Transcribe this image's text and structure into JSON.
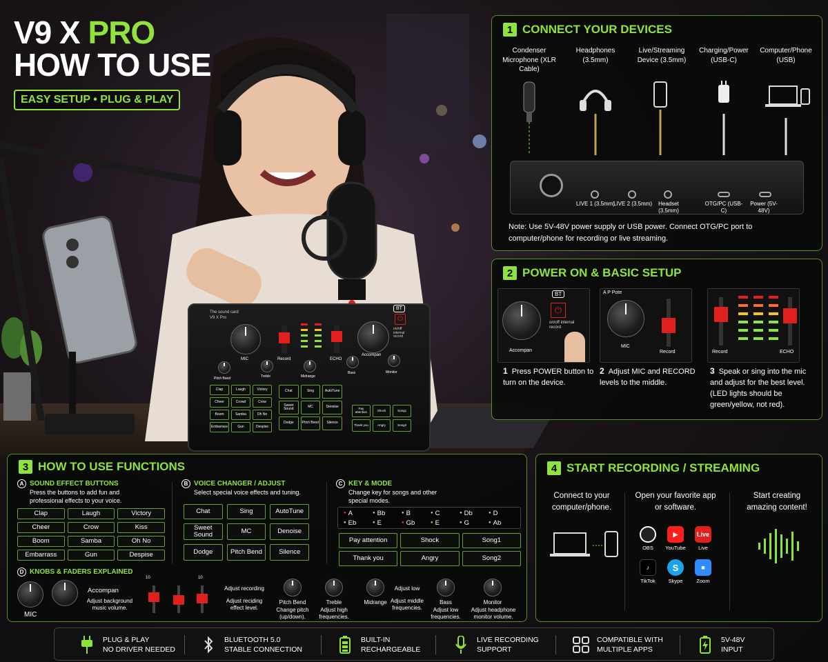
{
  "hero": {
    "title_part1": "V9 X",
    "title_part2": "PRO",
    "title_line2": "HOW TO USE",
    "tagline": "EASY SETUP • PLUG & PLAY"
  },
  "mixer_device": {
    "brand": "The sound card",
    "model": "V9 X Pro",
    "bt": "BT",
    "onoff": "on/off internal record",
    "labels": [
      "MIC",
      "Record",
      "ECHO",
      "Accompan",
      "Pitch Band",
      "Treble",
      "Midrange",
      "Bass",
      "Monitor"
    ],
    "pads_left": [
      "Clap",
      "Laugh",
      "Victory",
      "Cheer",
      "Crowd",
      "Crow",
      "Boom",
      "Samba",
      "Oh No",
      "Embarrass",
      "Gun",
      "Despise"
    ],
    "pads_mid": [
      "Chat",
      "Sing",
      "AutoTune",
      "Sweet Sound",
      "MC",
      "Denoise",
      "Dodge",
      "Pitch Bend",
      "Silence"
    ],
    "pads_right": [
      "Pay attention",
      "Shock",
      "Song1",
      "Thank you",
      "Angry",
      "Song2"
    ]
  },
  "step1": {
    "num": "1",
    "title": "CONNECT YOUR DEVICES",
    "devices": [
      {
        "name": "Condenser Microphone (XLR Cable)"
      },
      {
        "name": "Headphones (3.5mm)"
      },
      {
        "name": "Live/Streaming Device (3.5mm)"
      },
      {
        "name": "Charging/Power (USB-C)"
      },
      {
        "name": "Computer/Phone (USB)"
      }
    ],
    "ports": [
      "LIVE 1 (3.5mm)",
      "LIVE 2 (3.5mm)",
      "Headset (3.5mm)",
      "OTG/PC (USB-C)",
      "Power (5V-48V)"
    ],
    "note": "Note: Use 5V-48V power supply or USB power.  Connect OTG/PC port to computer/phone for recording or live streaming."
  },
  "step2": {
    "num": "2",
    "title": "POWER ON & BASIC SETUP",
    "cards": [
      {
        "knob_label": "Accompan",
        "bt": "BT",
        "onoff": "on/off internal record"
      },
      {
        "top": "A P Pote",
        "knob_label": "MIC",
        "fader_label": "Record"
      },
      {
        "left": "Record",
        "right": "ECHO"
      }
    ],
    "steps": [
      {
        "n": "1",
        "text": "Press POWER button to turn on the device."
      },
      {
        "n": "2",
        "text": "Adjust MIC and RECORD levels to the middle."
      },
      {
        "n": "3",
        "text": "Speak or sing into the mic and adjust for the best level. (LED lights should be green/yellow, not red)."
      }
    ]
  },
  "step3": {
    "num": "3",
    "title": "HOW TO USE FUNCTIONS",
    "a": {
      "letter": "A",
      "title": "SOUND EFFECT BUTTONS",
      "desc": "Press the buttons to add fun and professional effects to your voice.",
      "buttons": [
        "Clap",
        "Laugh",
        "Victory",
        "Cheer",
        "Crow",
        "Kiss",
        "Boom",
        "Samba",
        "Oh No",
        "Embarrass",
        "Gun",
        "Despise"
      ]
    },
    "b": {
      "letter": "B",
      "title": "VOICE CHANGER / ADJUST",
      "desc": "Select special voice effects and tuning.",
      "buttons": [
        "Chat",
        "Sing",
        "AutoTune",
        "Sweet Sound",
        "MC",
        "Denoise",
        "Dodge",
        "Pitch Bend",
        "Silence"
      ]
    },
    "c": {
      "letter": "C",
      "title": "KEY & MODE",
      "desc": "Change key for songs and other special modes.",
      "keys_row1": [
        "A",
        "Bb",
        "B",
        "C",
        "Db",
        "D"
      ],
      "keys_row2": [
        "Eb",
        "E",
        "Gb",
        "E",
        "G",
        "Ab"
      ],
      "buttons": [
        "Pay attention",
        "Shock",
        "Song1",
        "Thank you",
        "Angry",
        "Song2"
      ]
    },
    "d": {
      "letter": "D",
      "title": "KNOBS & FADERS EXPLAINED",
      "mic": "MIC",
      "accompan": "Accompan",
      "accompan_desc": "Adjust background music volume.",
      "fader_marks": [
        "10",
        "",
        "10"
      ],
      "adj_rec": "Adjust recording",
      "adj_eff": "Adjust reciding effect level.",
      "knobs": [
        {
          "name": "Pitch Bend",
          "desc": "Change pitch (up/down)."
        },
        {
          "name": "Treble",
          "desc": "Adjust high frequencies."
        },
        {
          "name": "Midrange",
          "desc": "Adjust middle frequencies.",
          "top": "Adjust low"
        },
        {
          "name": "Bass",
          "desc": "Adjust low frequencies."
        },
        {
          "name": "Monitor",
          "desc": "Adjust headphone monitor volume."
        }
      ]
    }
  },
  "step4": {
    "num": "4",
    "title": "START RECORDING / STREAMING",
    "col1": "Connect to your computer/phone.",
    "col2": "Open your favorite app or software.",
    "col3": "Start creating amazing content!",
    "apps": [
      {
        "name": "OBS",
        "icon": "obs-icon"
      },
      {
        "name": "YouTube",
        "icon": "youtube-icon"
      },
      {
        "name": "Live",
        "icon": "live-icon",
        "glyph": "Live"
      },
      {
        "name": "TikTok",
        "icon": "tiktok-icon"
      },
      {
        "name": "Skype",
        "icon": "skype-icon",
        "glyph": "S"
      },
      {
        "name": "Zoom",
        "icon": "zoom-icon"
      }
    ]
  },
  "features": [
    {
      "line1": "PLUG & PLAY",
      "line2": "NO DRIVER NEEDED",
      "icon": "plug-icon"
    },
    {
      "line1": "BLUETOOTH 5.0",
      "line2": "STABLE CONNECTION",
      "icon": "bluetooth-icon"
    },
    {
      "line1": "BUILT-IN",
      "line2": "RECHARGEABLE",
      "icon": "battery-icon"
    },
    {
      "line1": "LIVE RECORDING",
      "line2": "SUPPORT",
      "icon": "mic-icon"
    },
    {
      "line1": "COMPATIBLE WITH",
      "line2": "MULTIPLE APPS",
      "icon": "apps-grid-icon"
    },
    {
      "line1": "5V-48V",
      "line2": "INPUT",
      "icon": "power-bolt-icon"
    }
  ],
  "colors": {
    "accent": "#8fe33a",
    "fader_red": "#e0201c",
    "panel_bg": "#080a08"
  }
}
